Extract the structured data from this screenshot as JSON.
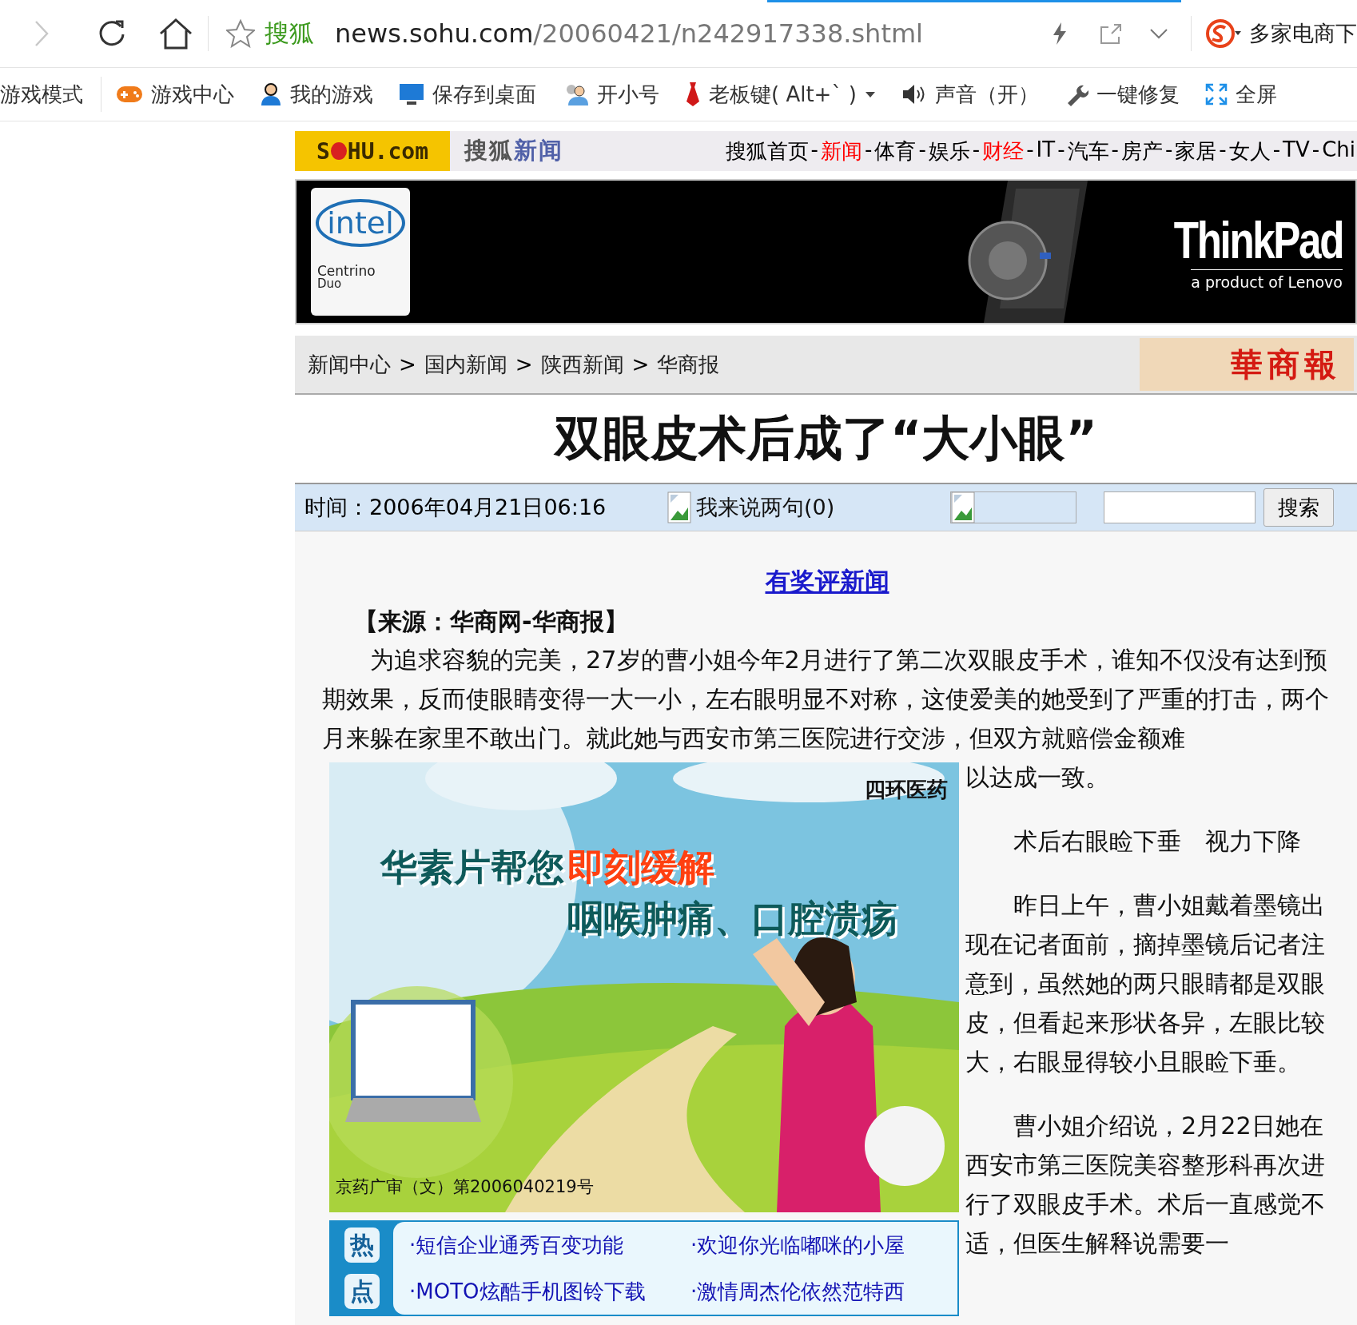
{
  "browser": {
    "back_disabled": true,
    "site_name": "搜狐",
    "url_domain": "news.sohu.com",
    "url_path": "/20060421/n242917338.shtml",
    "right_label": "多家电商下"
  },
  "toolbar": {
    "items": [
      {
        "label": "游戏模式",
        "kind": "text",
        "dropdown": false
      },
      {
        "label": "游戏中心",
        "kind": "gamepad",
        "dropdown": false
      },
      {
        "label": "我的游戏",
        "kind": "person",
        "dropdown": false
      },
      {
        "label": "保存到桌面",
        "kind": "monitor",
        "dropdown": false
      },
      {
        "label": "开小号",
        "kind": "people",
        "dropdown": false
      },
      {
        "label": "老板键( Alt+` )",
        "kind": "tie",
        "dropdown": true
      },
      {
        "label": "声音（开）",
        "kind": "speaker",
        "dropdown": false
      },
      {
        "label": "一键修复",
        "kind": "wrench",
        "dropdown": false
      },
      {
        "label": "全屏",
        "kind": "fullscreen",
        "dropdown": false
      }
    ]
  },
  "site_header": {
    "logo_start": "S",
    "logo_end": "HU.com",
    "section_site": "搜狐",
    "section_name": "新闻",
    "nav": [
      {
        "kind": "link",
        "label": "搜狐首页",
        "color": "#000000"
      },
      {
        "kind": "separator",
        "label": "-"
      },
      {
        "kind": "link",
        "label": "新闻",
        "color": "#ff0000"
      },
      {
        "kind": "separator",
        "label": "-"
      },
      {
        "kind": "link",
        "label": "体育",
        "color": "#000000"
      },
      {
        "kind": "separator",
        "label": "-"
      },
      {
        "kind": "link",
        "label": "娱乐",
        "color": "#000000"
      },
      {
        "kind": "separator",
        "label": "-"
      },
      {
        "kind": "link",
        "label": "财经",
        "color": "#ff0000"
      },
      {
        "kind": "separator",
        "label": "-"
      },
      {
        "kind": "link",
        "label": "IT",
        "color": "#000000"
      },
      {
        "kind": "separator",
        "label": "-"
      },
      {
        "kind": "link",
        "label": "汽车",
        "color": "#000000"
      },
      {
        "kind": "separator",
        "label": "-"
      },
      {
        "kind": "link",
        "label": "房产",
        "color": "#000000"
      },
      {
        "kind": "separator",
        "label": "-"
      },
      {
        "kind": "link",
        "label": "家居",
        "color": "#000000"
      },
      {
        "kind": "separator",
        "label": "-"
      },
      {
        "kind": "link",
        "label": "女人",
        "color": "#000000"
      },
      {
        "kind": "separator",
        "label": "-"
      },
      {
        "kind": "link",
        "label": "TV",
        "color": "#000000"
      },
      {
        "kind": "separator",
        "label": "-"
      },
      {
        "kind": "link",
        "label": "Chi",
        "color": "#000000"
      }
    ]
  },
  "banner": {
    "brand_top": "intel",
    "brand_sub": "Centrino",
    "brand_sub2": "Duo",
    "product": "ThinkPad",
    "tagline": "a product of Lenovo"
  },
  "breadcrumb": {
    "items": [
      {
        "kind": "link",
        "label": "新闻中心"
      },
      {
        "kind": "separator",
        "label": ">"
      },
      {
        "kind": "link",
        "label": "国内新闻"
      },
      {
        "kind": "separator",
        "label": ">"
      },
      {
        "kind": "link",
        "label": "陕西新闻"
      },
      {
        "kind": "separator",
        "label": ">"
      },
      {
        "kind": "link",
        "label": "华商报"
      }
    ],
    "paper_logo": "華商報"
  },
  "article": {
    "title": "双眼皮术后成了“大小眼”",
    "meta": {
      "time": "时间：2006年04月21日06:16",
      "comments": "我来说两句(0)",
      "search_button": "搜索"
    },
    "promo_link": "有奖评新闻",
    "source": "【来源：华商网-华商报】",
    "paragraphs": [
      {
        "kind": "text",
        "text": "　　为追求容貌的完美，27岁的曹小姐今年2月进行了第二次双眼皮手术，谁知不仅没有达到预期效果，反而使眼睛变得一大一小，左右眼明显不对称，这使爱美的她受到了严重的打击，两个月来躲在家里不敢出门。就此她与西安市第三医院进行交涉，但双方就赔偿金额难",
        "continuation": "以达成一致。"
      },
      {
        "kind": "subhead",
        "text": "　　术后右眼睑下垂　视力下降"
      },
      {
        "kind": "text",
        "text": "　　昨日上午，曹小姐戴着墨镜出现在记者面前，摘掉墨镜后记者注意到，虽然她的两只眼睛都是双眼皮，但看起来形状各异，左眼比较大，右眼显得较小且眼睑下垂。"
      },
      {
        "kind": "text",
        "text": "　　曹小姐介绍说，2月22日她在西安市第三医院美容整形科再次进行了双眼皮手术。术后一直感觉不适，但医生解释说需要一"
      }
    ],
    "ad": {
      "brand": "四环医药",
      "headline_start": "华素片帮您",
      "headline_accent": "即刻缓解",
      "headline_second": "咽喉肿痛、口腔溃疡",
      "approval": "京药广审（文）第2006040219号"
    },
    "hot_links": {
      "badge_top": "热",
      "badge_bottom": "点",
      "links": [
        "·短信企业通秀百变功能",
        "·欢迎你光临嘟咪的小屋",
        "·MOTO炫酷手机图铃下载",
        "·激情周杰伦依然范特西"
      ]
    }
  }
}
